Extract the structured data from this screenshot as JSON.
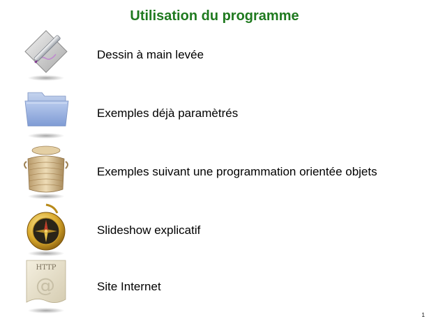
{
  "title": "Utilisation du programme",
  "items": [
    {
      "label": "Dessin à main levée",
      "icon": "drawing-pen-icon"
    },
    {
      "label": "Exemples déjà paramètrés",
      "icon": "folder-icon"
    },
    {
      "label": "Exemples suivant une programmation orientée objets",
      "icon": "basket-icon"
    },
    {
      "label": "Slideshow explicatif",
      "icon": "compass-icon"
    },
    {
      "label": "Site Internet",
      "icon": "http-document-icon",
      "icon_text": [
        "HTTP",
        "@"
      ]
    }
  ],
  "page_number": "1",
  "colors": {
    "title": "#1f7a1f",
    "text": "#000000",
    "background": "#ffffff"
  }
}
